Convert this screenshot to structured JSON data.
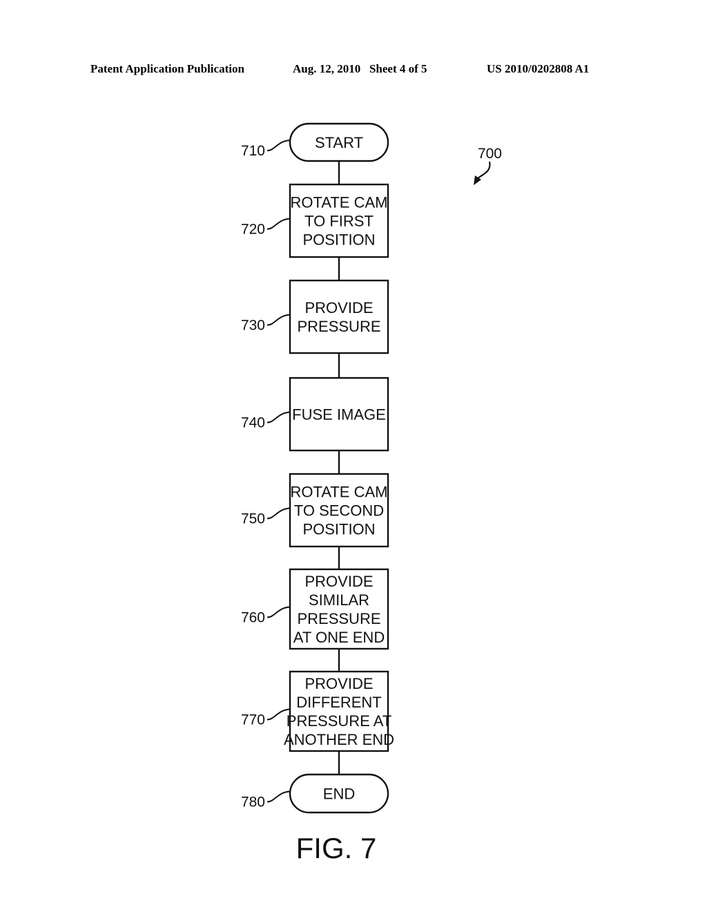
{
  "header": {
    "publication": "Patent Application Publication",
    "date_sheet": "Aug. 12, 2010   Sheet 4 of 5",
    "number": "US 2010/0202808 A1"
  },
  "figure": {
    "label": "FIG. 7",
    "reference": "700",
    "steps": [
      {
        "ref": "710",
        "shape": "terminal",
        "lines": [
          "START"
        ]
      },
      {
        "ref": "720",
        "shape": "process",
        "lines": [
          "ROTATE CAM",
          "TO FIRST",
          "POSITION"
        ]
      },
      {
        "ref": "730",
        "shape": "process",
        "lines": [
          "PROVIDE",
          "PRESSURE"
        ]
      },
      {
        "ref": "740",
        "shape": "process",
        "lines": [
          "FUSE IMAGE"
        ]
      },
      {
        "ref": "750",
        "shape": "process",
        "lines": [
          "ROTATE CAM",
          "TO SECOND",
          "POSITION"
        ]
      },
      {
        "ref": "760",
        "shape": "process",
        "lines": [
          "PROVIDE",
          "SIMILAR",
          "PRESSURE",
          "AT ONE END"
        ]
      },
      {
        "ref": "770",
        "shape": "process",
        "lines": [
          "PROVIDE",
          "DIFFERENT",
          "PRESSURE AT",
          "ANOTHER END"
        ]
      },
      {
        "ref": "780",
        "shape": "terminal",
        "lines": [
          "END"
        ]
      }
    ]
  }
}
